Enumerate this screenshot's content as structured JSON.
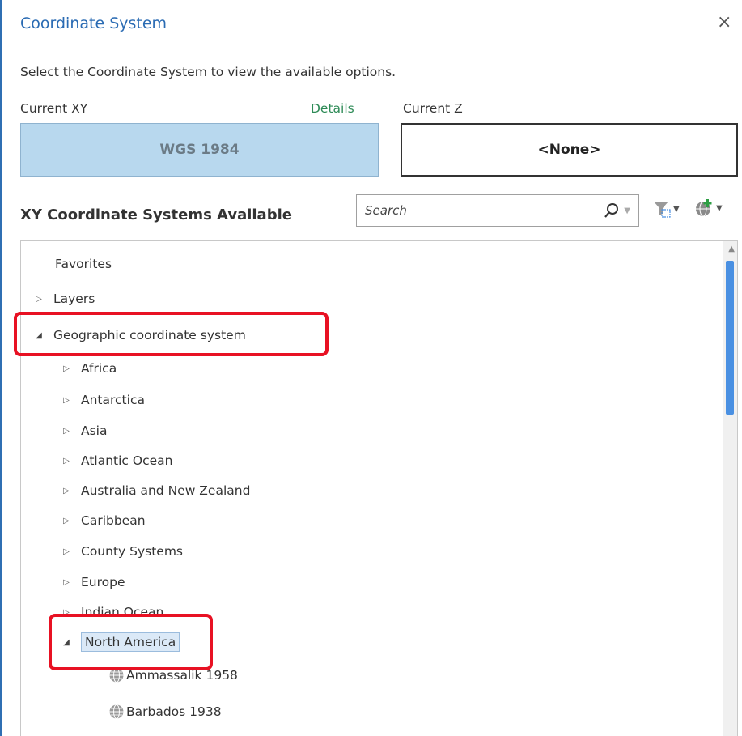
{
  "dialog": {
    "title": "Coordinate System",
    "close_label": "×",
    "subtitle": "Select the Coordinate System to view the available options."
  },
  "current_xy": {
    "label": "Current XY",
    "details_link": "Details",
    "value": "WGS 1984"
  },
  "current_z": {
    "label": "Current Z",
    "value": "<None>"
  },
  "available": {
    "title": "XY Coordinate Systems Available",
    "search_placeholder": "Search"
  },
  "tree": {
    "favorites": "Favorites",
    "layers": "Layers",
    "geographic": "Geographic coordinate system",
    "children": [
      "Africa",
      "Antarctica",
      "Asia",
      "Atlantic Ocean",
      "Australia and New Zealand",
      "Caribbean",
      "County Systems",
      "Europe",
      "Indian Ocean"
    ],
    "north_america": "North America",
    "leaves": [
      "Ammassalik 1958",
      "Barbados 1938"
    ]
  },
  "colors": {
    "title_blue": "#2a6bb3",
    "details_green": "#2e8b57",
    "xy_fill": "#b8d8ee",
    "highlight_red": "#e81123",
    "scroll_blue": "#4a90e2"
  }
}
